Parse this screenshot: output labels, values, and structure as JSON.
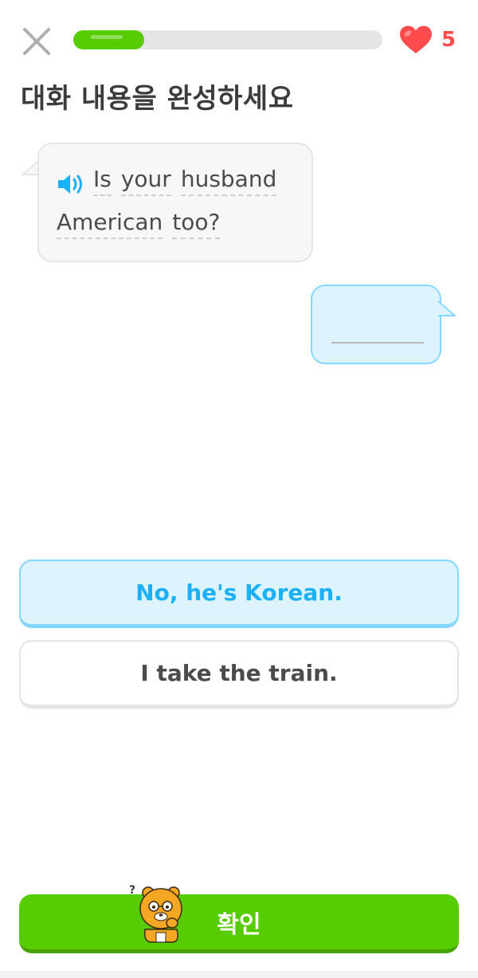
{
  "header": {
    "progress_fraction": 0.23,
    "hearts_count": "5"
  },
  "title": "대화 내용을 완성하세요",
  "prompt": {
    "line1": [
      "Is",
      "your",
      "husband"
    ],
    "line2": [
      "American",
      "too?"
    ]
  },
  "choices": [
    {
      "label": "No, he's Korean.",
      "selected": true
    },
    {
      "label": "I take the train.",
      "selected": false
    }
  ],
  "check_button_label": "확인",
  "colors": {
    "green": "#58cc02",
    "blue": "#1cb0f6",
    "blue_bg": "#ddf4ff",
    "heart_red": "#ff4b4b"
  },
  "icons": {
    "close": "close-icon",
    "heart": "heart-icon",
    "speaker": "speaker-icon",
    "mascot": "bear-mascot-icon"
  }
}
